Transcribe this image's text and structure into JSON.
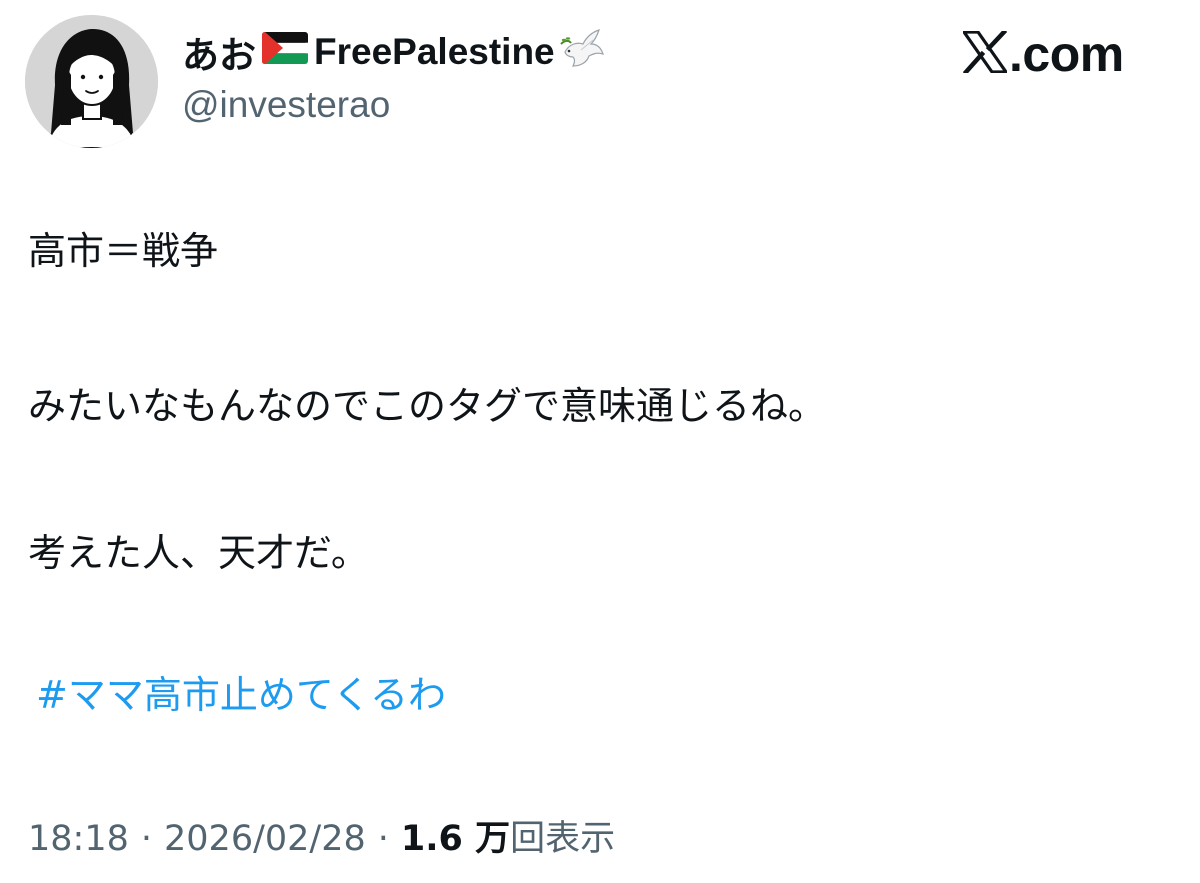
{
  "author": {
    "display_name": "あお",
    "display_name_suffix": "FreePalestine",
    "handle": "@investerao",
    "flag_icon": "palestine-flag-icon",
    "dove_icon": "dove-icon",
    "avatar_icon": "user-avatar-illustration"
  },
  "brand": {
    "logo_text": ".com",
    "logo_icon": "x-logo-icon"
  },
  "tweet": {
    "lines": [
      "高市＝戦争",
      "みたいなもんなのでこのタグで意味通じるね。",
      "考えた人、天才だ。"
    ],
    "hashtag": "#ママ高市止めてくるわ"
  },
  "meta": {
    "time": "18:18",
    "date": "2026/02/28",
    "separator": "·",
    "views_count": "1.6 万",
    "views_label": "回表示"
  },
  "colors": {
    "text": "#0f1419",
    "secondary": "#536471",
    "link": "#1d9bf0",
    "avatar_bg": "#d5d5d5"
  }
}
